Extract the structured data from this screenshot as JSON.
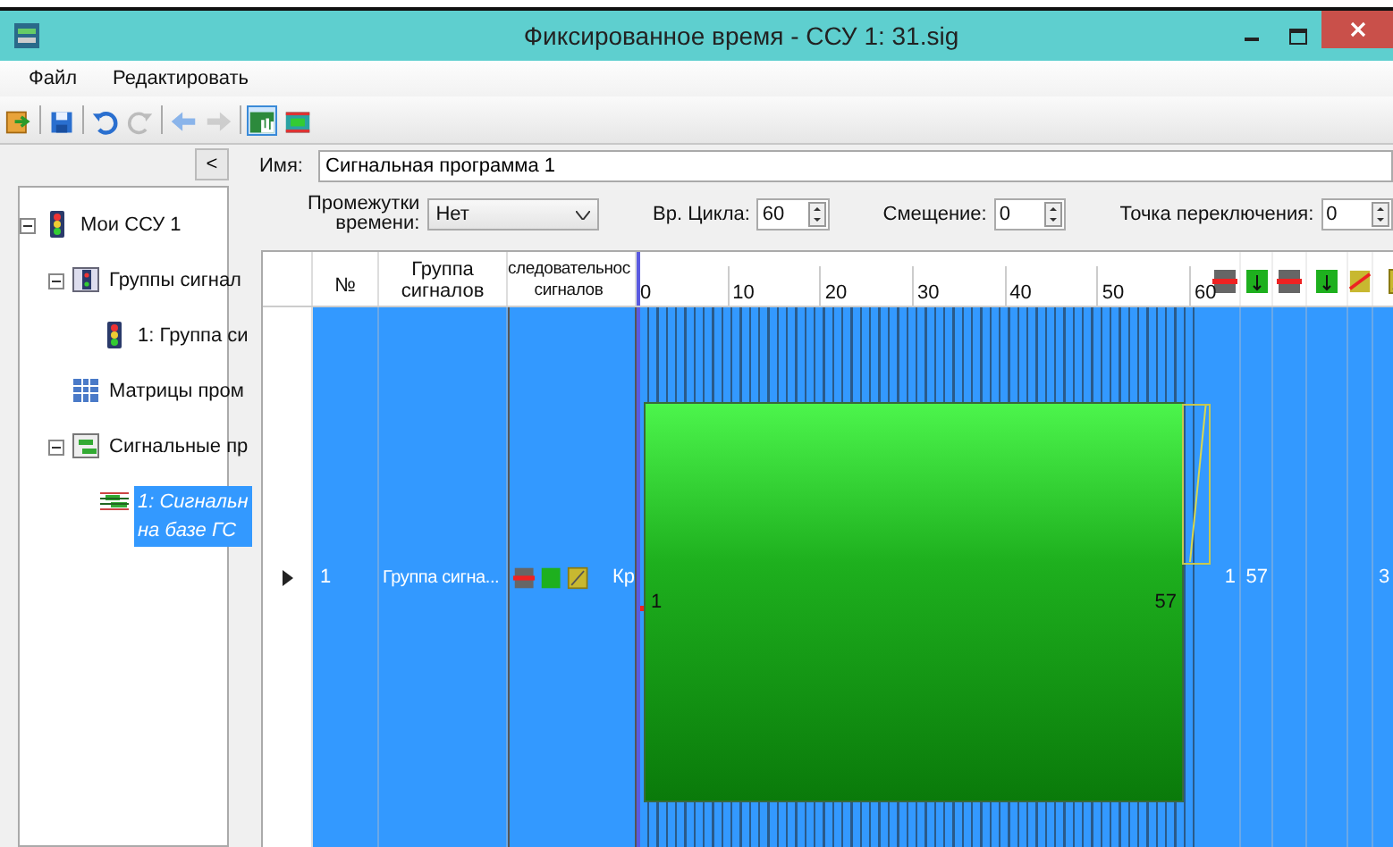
{
  "window": {
    "title": "Фиксированное время - ССУ 1: 31.sig"
  },
  "menu": [
    "Файл",
    "Редактировать"
  ],
  "toolbar": [
    {
      "kind": "open",
      "disabled": false,
      "selected": false
    },
    {
      "kind": "separator"
    },
    {
      "kind": "save",
      "disabled": false,
      "selected": false
    },
    {
      "kind": "separator"
    },
    {
      "kind": "undo",
      "disabled": false,
      "selected": false
    },
    {
      "kind": "redo",
      "disabled": true,
      "selected": false
    },
    {
      "kind": "separator"
    },
    {
      "kind": "back",
      "disabled": false,
      "selected": false
    },
    {
      "kind": "forward",
      "disabled": true,
      "selected": false
    },
    {
      "kind": "separator"
    },
    {
      "kind": "hand",
      "disabled": false,
      "selected": true
    },
    {
      "kind": "stripes",
      "disabled": false,
      "selected": false
    }
  ],
  "collapse_button": "<",
  "tree": [
    {
      "label": "Мои ССУ 1",
      "kind": "lights",
      "expanded": true,
      "selected": false,
      "children": [
        {
          "label": "Группы сигнал",
          "kind": "group",
          "expanded": true,
          "selected": false,
          "children": [
            {
              "label": "1: Группа си",
              "kind": "lights",
              "selected": false
            }
          ]
        },
        {
          "label": "Матрицы пром",
          "kind": "matrix",
          "selected": false
        },
        {
          "label": "Сигнальные пр",
          "kind": "program",
          "expanded": true,
          "selected": false,
          "children": [
            {
              "label": "1: Сигнальн\nна базе ГС",
              "kind": "program-item",
              "selected": true
            }
          ]
        }
      ]
    }
  ],
  "name_field": {
    "label": "Имя:",
    "value": "Сигнальная программа 1"
  },
  "options": {
    "intervals_label": "Промежутки\nвремени:",
    "intervals_value": "Нет",
    "spinners": [
      {
        "label": "Вр. Цикла:",
        "value": "60"
      },
      {
        "label": "Смещение:",
        "value": "0"
      },
      {
        "label": "Точка переключения:",
        "value": "0"
      }
    ]
  },
  "table": {
    "columns": [
      "№",
      "Группа\nсигналов",
      "следовательнос\nсигналов"
    ],
    "scale_labels": [
      "0",
      "10",
      "20",
      "30",
      "40",
      "50",
      "60"
    ],
    "extra_columns": [
      {
        "kind": "stop"
      },
      {
        "kind": "go"
      },
      {
        "kind": "stop"
      },
      {
        "kind": "go"
      },
      {
        "kind": "amber-off"
      },
      {
        "kind": "amber"
      }
    ],
    "rows": [
      {
        "number": "1",
        "group": "Группа сигна...",
        "sequence_label": "Кр",
        "start": "1",
        "end": "57",
        "extra": [
          "1",
          "57"
        ],
        "column_6": "3"
      }
    ]
  }
}
